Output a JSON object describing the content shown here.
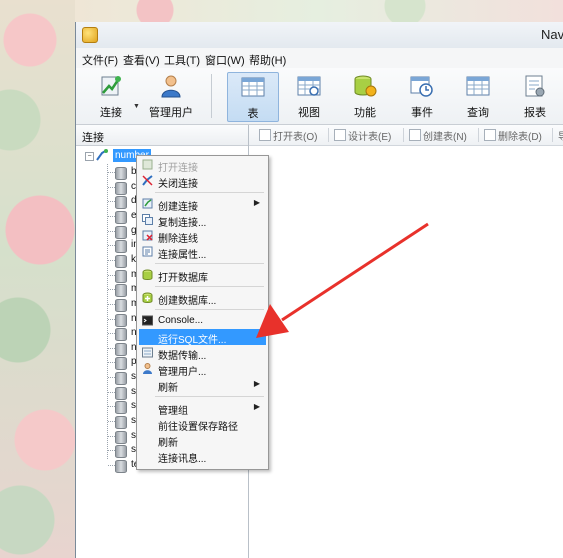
{
  "window": {
    "title": "Nav"
  },
  "menubar": {
    "items": [
      "文件(F)",
      "查看(V)",
      "工具(T)",
      "窗口(W)",
      "帮助(H)"
    ]
  },
  "toolbar": {
    "buttons": [
      {
        "label": "连接",
        "icon": "connect-icon"
      },
      {
        "label": "管理用户",
        "icon": "user-icon"
      },
      {
        "label": "表",
        "icon": "table-icon",
        "active": true
      },
      {
        "label": "视图",
        "icon": "view-icon"
      },
      {
        "label": "功能",
        "icon": "function-icon"
      },
      {
        "label": "事件",
        "icon": "event-icon"
      },
      {
        "label": "查询",
        "icon": "query-icon"
      },
      {
        "label": "报表",
        "icon": "report-icon"
      }
    ]
  },
  "connection_panel": {
    "header": "连接",
    "connection_name": "number",
    "databases": [
      "b",
      "c",
      "d",
      "e",
      "g",
      "in",
      "k",
      "m",
      "m",
      "m",
      "n",
      "n",
      "n",
      "p",
      "s",
      "s",
      "s",
      "s",
      "s",
      "s",
      "te"
    ]
  },
  "object_toolbar": {
    "buttons": [
      "打开表(O)",
      "设计表(E)",
      "创建表(N)",
      "删除表(D)",
      "导入"
    ]
  },
  "context_menu": {
    "groups": [
      [
        {
          "label": "打开连接",
          "disabled": true,
          "icon": "open-connection-icon"
        },
        {
          "label": "关闭连接",
          "icon": "close-connection-icon"
        }
      ],
      [
        {
          "label": "创建连接",
          "icon": "new-connection-icon",
          "submenu": true
        },
        {
          "label": "复制连接...",
          "icon": "copy-connection-icon"
        },
        {
          "label": "删除连线",
          "icon": "delete-connection-icon"
        },
        {
          "label": "连接属性...",
          "icon": "connection-properties-icon"
        }
      ],
      [
        {
          "label": "打开数据库",
          "icon": "open-database-icon"
        }
      ],
      [
        {
          "label": "创建数据库...",
          "icon": "new-database-icon"
        }
      ],
      [
        {
          "label": "Console...",
          "icon": "console-icon"
        },
        {
          "label": "运行SQL文件...",
          "highlight": true
        },
        {
          "label": "数据传输...",
          "icon": "data-transfer-icon"
        },
        {
          "label": "管理用户...",
          "icon": "manage-users-icon"
        },
        {
          "label": "刷新",
          "submenu": true
        }
      ],
      [
        {
          "label": "管理组",
          "submenu": true
        },
        {
          "label": "前往设置保存路径"
        },
        {
          "label": "刷新"
        },
        {
          "label": "连接讯息..."
        }
      ]
    ]
  },
  "colors": {
    "highlight": "#3399ff",
    "annotation_arrow": "#e8312b"
  }
}
